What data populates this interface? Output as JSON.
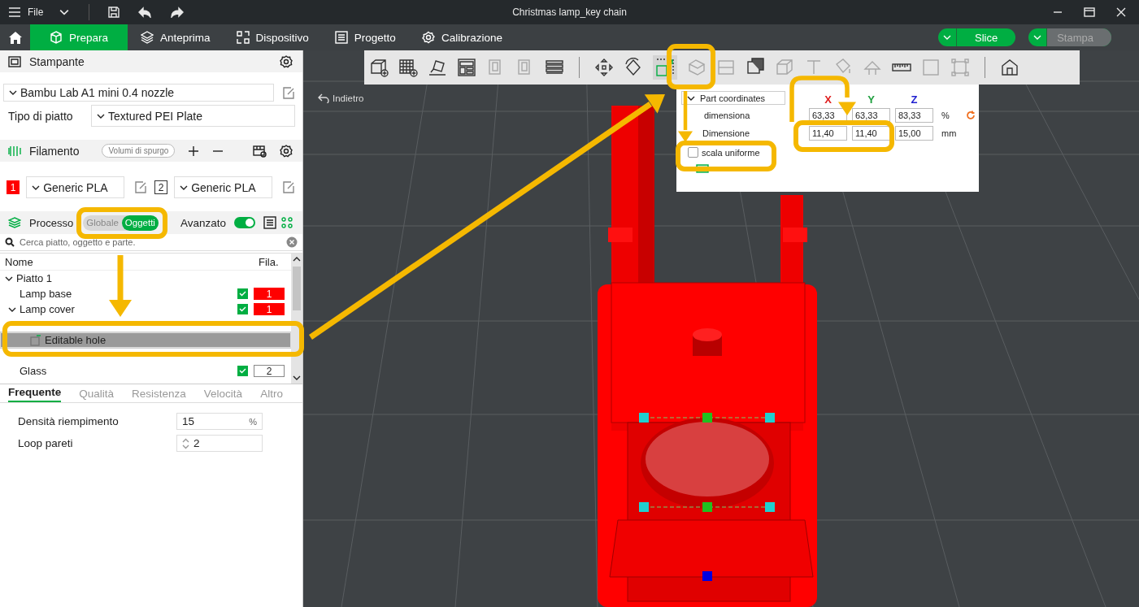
{
  "window": {
    "menu": "File",
    "title": "Christmas lamp_key chain"
  },
  "tabs": [
    {
      "label": "Prepara",
      "selected": true
    },
    {
      "label": "Anteprima",
      "selected": false
    },
    {
      "label": "Dispositivo",
      "selected": false
    },
    {
      "label": "Progetto",
      "selected": false
    },
    {
      "label": "Calibrazione",
      "selected": false
    }
  ],
  "actions": [
    {
      "label": "Slice",
      "enabled": true
    },
    {
      "label": "Stampa",
      "enabled": false
    }
  ],
  "printer": {
    "title": "Stampante",
    "model": "Bambu Lab A1 mini 0.4 nozzle",
    "plate_label": "Tipo di piatto",
    "plate": "Textured PEI Plate"
  },
  "filament": {
    "title": "Filamento",
    "purge_button": "Volumi di spurgo",
    "slots": [
      {
        "number": "1",
        "name": "Generic PLA",
        "color": "#ff0000"
      },
      {
        "number": "2",
        "name": "Generic PLA",
        "color": "#ffffff"
      }
    ]
  },
  "process": {
    "title": "Processo",
    "modes": [
      {
        "label": "Globale",
        "selected": false
      },
      {
        "label": "Oggetti",
        "selected": true
      }
    ],
    "advanced_label": "Avanzato",
    "advanced_on": true
  },
  "search": {
    "placeholder": "Cerca piatto, oggetto e parte."
  },
  "objects": {
    "columns": [
      "Nome",
      "Fila."
    ],
    "tree": [
      {
        "name": "Piatto 1",
        "expanded": true,
        "selected": false,
        "children": [
          {
            "name": "Lamp base",
            "selected": false,
            "visible": true,
            "filament": "1",
            "color": "#ff0000"
          },
          {
            "name": "Lamp cover",
            "expanded": true,
            "selected": false,
            "visible": true,
            "filament": "1",
            "color": "#ff0000",
            "children": [
              {
                "name": "Editable hole",
                "selected": true
              }
            ]
          },
          {
            "name": "Glass",
            "selected": false,
            "visible": true,
            "filament": "2",
            "color": "#ffffff"
          }
        ]
      }
    ]
  },
  "settings_tabs": [
    {
      "label": "Frequente",
      "selected": true
    },
    {
      "label": "Qualità",
      "selected": false
    },
    {
      "label": "Resistenza",
      "selected": false
    },
    {
      "label": "Velocità",
      "selected": false
    },
    {
      "label": "Altro",
      "selected": false
    }
  ],
  "settings": [
    {
      "kind": "percent",
      "label": "Densità riempimento",
      "value": "15",
      "unit": "%"
    },
    {
      "kind": "spin",
      "label": "Loop pareti",
      "value": "2"
    }
  ],
  "viewport": {
    "back_button": "Indietro"
  },
  "scale_panel": {
    "coordinates": "Part coordinates",
    "axes": [
      {
        "label": "X",
        "color": "#e02020"
      },
      {
        "label": "Y",
        "color": "#20a040"
      },
      {
        "label": "Z",
        "color": "#2020d0"
      }
    ],
    "rows": [
      {
        "label": "dimensiona",
        "values": [
          "63,33",
          "63,33",
          "83,33"
        ],
        "unit": "%",
        "reset": true
      },
      {
        "label": "Dimensione",
        "values": [
          "11,40",
          "11,40",
          "15,00"
        ],
        "unit": "mm",
        "reset": false
      }
    ],
    "uniform": {
      "label": "scala uniforme",
      "checked": false
    }
  }
}
